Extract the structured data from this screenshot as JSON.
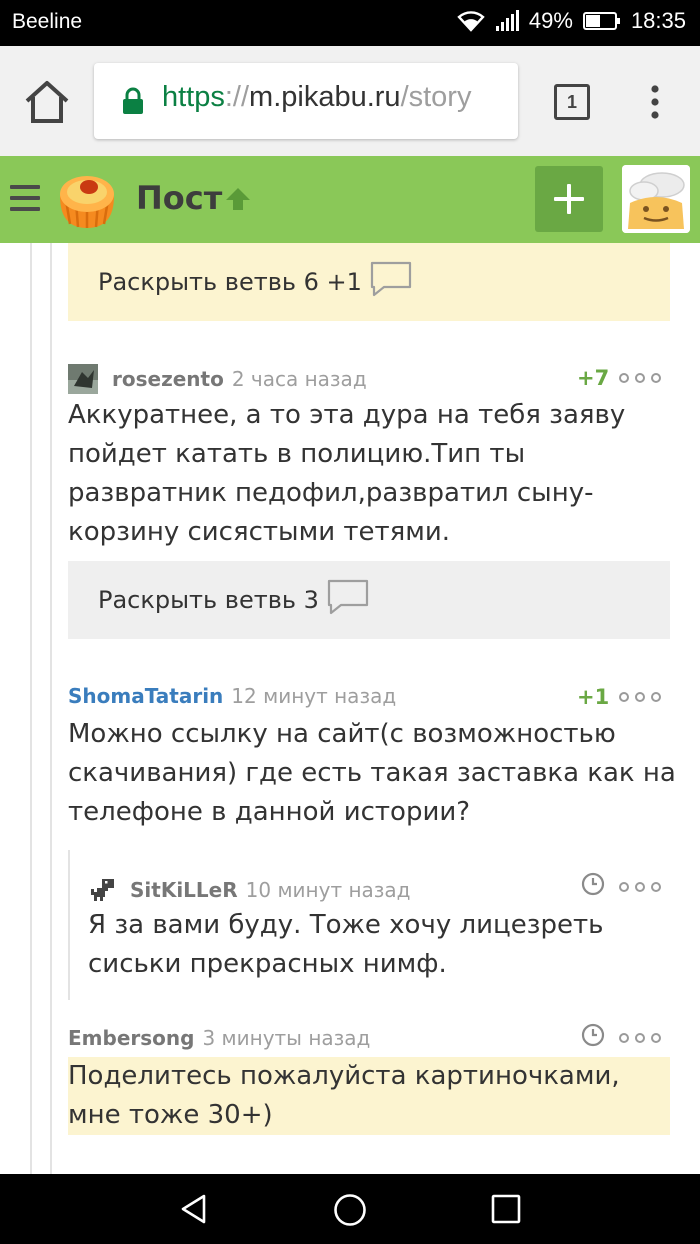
{
  "status_bar": {
    "carrier": "Beeline",
    "battery": "49%",
    "time": "18:35",
    "icons": [
      "wifi-icon",
      "signal-icon",
      "battery-icon"
    ]
  },
  "browser": {
    "url_scheme": "https",
    "url_sep": "://",
    "url_host": "m.pikabu.ru",
    "url_path": "/story",
    "tab_count": "1",
    "icons": [
      "home-icon",
      "lock-icon",
      "overflow-menu-icon"
    ]
  },
  "site_header": {
    "title": "Пост",
    "icons": [
      "hamburger-icon",
      "pikabu-logo-icon",
      "up-arrow-icon",
      "plus-icon",
      "user-avatar"
    ]
  },
  "comments": {
    "branch1_label": "Раскрыть ветвь 6 +1",
    "c1": {
      "author": "rosezento",
      "time": "2 часа назад",
      "rating": "+7",
      "text": "Аккуратнее, а то эта дура на тебя заяву пойдет катать в полицию.Тип ты развратник педофил,развратил сыну- корзину сисястыми тетями."
    },
    "branch2_label": "Раскрыть ветвь 3",
    "c2": {
      "author": "ShomaTatarin",
      "time": "12 минут назад",
      "rating": "+1",
      "text": "Можно ссылку на сайт(с возможностью скачивания) где есть такая заставка как на телефоне в данной истории?"
    },
    "c3": {
      "author": "SitKiLLeR",
      "time": "10 минут назад",
      "text": "Я за вами буду. Тоже хочу лицезреть сиськи прекрасных нимф."
    },
    "c4": {
      "author": "Embersong",
      "time": "3 минуты назад",
      "text": "Поделитесь пожалуйста картиночками, мне тоже 30+)"
    }
  },
  "colors": {
    "header_green": "#8ac858",
    "button_green": "#6aa844",
    "highlight_yellow": "#fcf4d0",
    "author_blue": "#3a7dbd"
  },
  "nav_icons": [
    "back-icon",
    "home-circle-icon",
    "recents-icon"
  ]
}
